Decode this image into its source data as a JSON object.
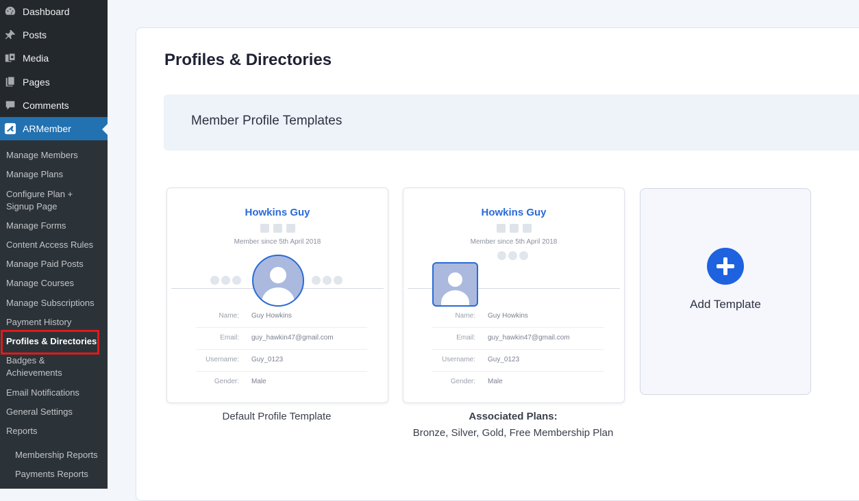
{
  "sidebar": {
    "top_items": [
      {
        "label": "Dashboard",
        "icon": "dashboard-icon"
      },
      {
        "label": "Posts",
        "icon": "pushpin-icon"
      },
      {
        "label": "Media",
        "icon": "media-icon"
      },
      {
        "label": "Pages",
        "icon": "pages-icon"
      },
      {
        "label": "Comments",
        "icon": "comment-icon"
      },
      {
        "label": "ARMember",
        "icon": "armember-icon"
      }
    ],
    "submenu": [
      "Manage Members",
      "Manage Plans",
      "Configure Plan +\nSignup Page",
      "Manage Forms",
      "Content Access Rules",
      "Manage Paid Posts",
      "Manage Courses",
      "Manage Subscriptions",
      "Payment History",
      "Profiles & Directories",
      "Badges &\nAchievements",
      "Email Notifications",
      "General Settings",
      "Reports",
      "Membership Reports",
      "Payments Reports"
    ],
    "accent": "#2271b1",
    "highlight_color": "#e01a1a"
  },
  "main": {
    "title": "Profiles & Directories",
    "section_title": "Member Profile Templates"
  },
  "profile_preview": {
    "name": "Howkins Guy",
    "since": "Member since 5th April 2018",
    "fields": [
      {
        "key": "Name:",
        "value": "Guy Howkins"
      },
      {
        "key": "Email:",
        "value": "guy_hawkin47@gmail.com"
      },
      {
        "key": "Username:",
        "value": "Guy_0123"
      },
      {
        "key": "Gender:",
        "value": "Male"
      }
    ]
  },
  "templates": [
    {
      "caption": "Default Profile Template"
    },
    {
      "caption_title": "Associated Plans:",
      "caption_body": "Bronze, Silver, Gold, Free Membership Plan"
    }
  ],
  "add_template": {
    "label": "Add Template",
    "accent": "#1e62e0"
  }
}
